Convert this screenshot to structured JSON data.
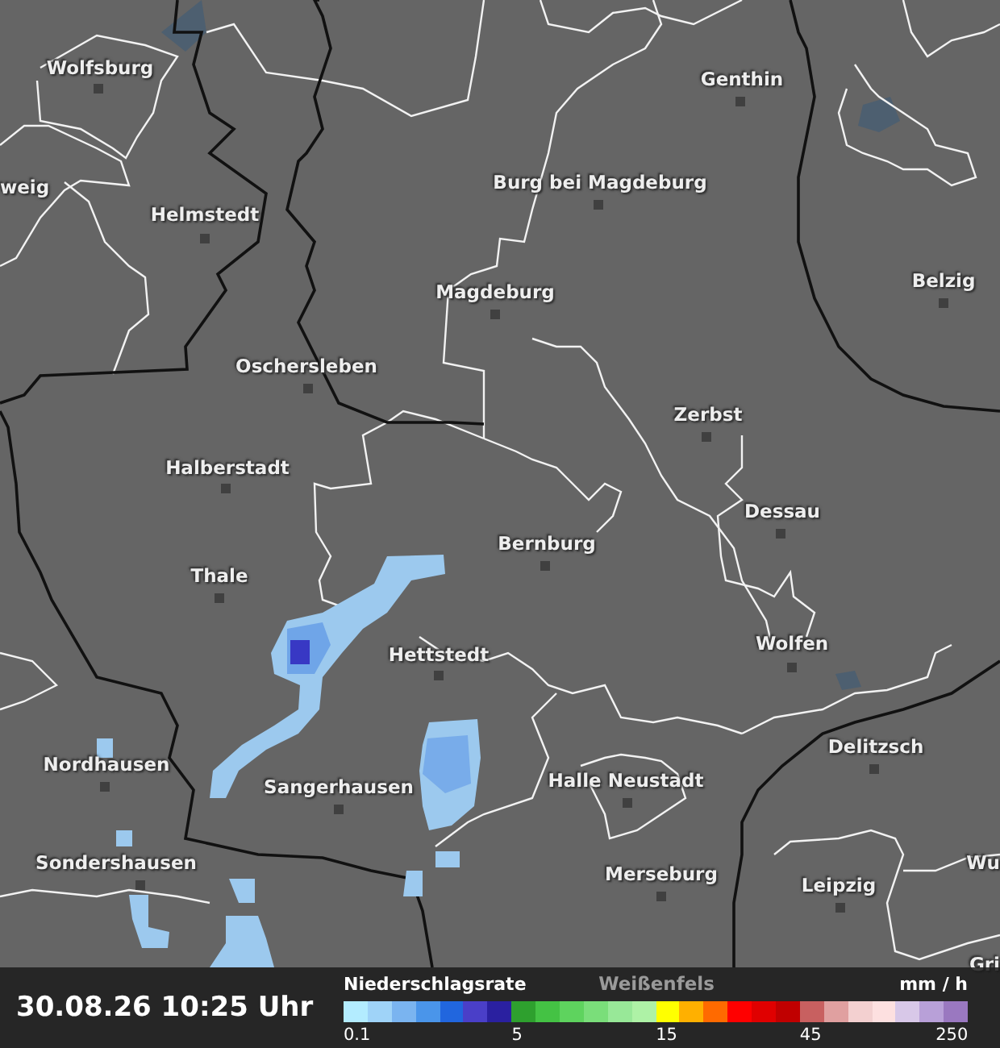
{
  "map": {
    "cities": [
      {
        "name": "Wolfsburg"
      },
      {
        "name": "Genthin"
      },
      {
        "name": "weig"
      },
      {
        "name": "Helmstedt"
      },
      {
        "name": "Burg bei Magdeburg"
      },
      {
        "name": "Magdeburg"
      },
      {
        "name": "Belzig"
      },
      {
        "name": "Oschersleben"
      },
      {
        "name": "Zerbst"
      },
      {
        "name": "Halberstadt"
      },
      {
        "name": "Dessau"
      },
      {
        "name": "Bernburg"
      },
      {
        "name": "Thale"
      },
      {
        "name": "Wolfen"
      },
      {
        "name": "Hettstedt"
      },
      {
        "name": "Delitzsch"
      },
      {
        "name": "Nordhausen"
      },
      {
        "name": "Halle Neustadt"
      },
      {
        "name": "Sangerhausen"
      },
      {
        "name": "Wu"
      },
      {
        "name": "Sondershausen"
      },
      {
        "name": "Merseburg"
      },
      {
        "name": "Leipzig"
      },
      {
        "name": "Gri"
      },
      {
        "name": "Weißenfels",
        "dimmed": true
      }
    ]
  },
  "footer": {
    "timestamp": "30.08.26 10:25 Uhr",
    "legend": {
      "title": "Niederschlagsrate",
      "unit": "mm / h",
      "swatches": [
        {
          "color": "#b3ecff",
          "tick": "0.1"
        },
        {
          "color": "#9fd3f8"
        },
        {
          "color": "#7ab4f0"
        },
        {
          "color": "#4a95ea"
        },
        {
          "color": "#2166de"
        },
        {
          "color": "#4a3fc8"
        },
        {
          "color": "#2a20a0"
        },
        {
          "color": "#2ea02e",
          "tick": "5"
        },
        {
          "color": "#44c244"
        },
        {
          "color": "#5ed35e"
        },
        {
          "color": "#7ade7a"
        },
        {
          "color": "#98e898"
        },
        {
          "color": "#aef2a6"
        },
        {
          "color": "#ffff00",
          "tick": "15"
        },
        {
          "color": "#ffb000"
        },
        {
          "color": "#ff6a00"
        },
        {
          "color": "#ff0000"
        },
        {
          "color": "#e00000"
        },
        {
          "color": "#c00000"
        },
        {
          "color": "#c86060",
          "tick": "45"
        },
        {
          "color": "#e0a0a0"
        },
        {
          "color": "#f3d0d0"
        },
        {
          "color": "#fde0e0"
        },
        {
          "color": "#d8c8e8"
        },
        {
          "color": "#b8a0d8"
        },
        {
          "color": "#9a78c0",
          "tick": "250"
        }
      ]
    }
  }
}
